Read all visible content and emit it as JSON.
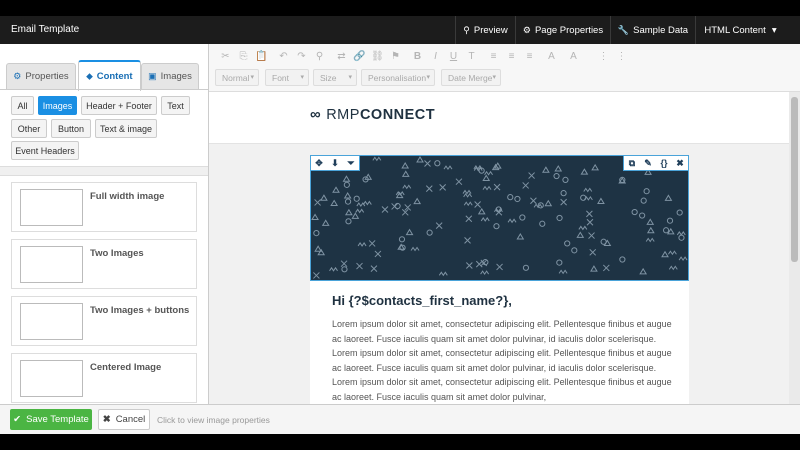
{
  "window": {
    "title": "Email Template"
  },
  "nav": [
    {
      "icon": "search-icon",
      "glyph": "⚲",
      "label": "Preview"
    },
    {
      "icon": "gear-icon",
      "glyph": "⚙",
      "label": "Page Properties"
    },
    {
      "icon": "wrench-icon",
      "glyph": "🔧",
      "label": "Sample Data"
    },
    {
      "icon": "chevron-down-icon",
      "glyph": "▾",
      "label": "HTML Content"
    }
  ],
  "left_tabs": [
    {
      "icon": "gear-icon",
      "glyph": "⚙",
      "label": "Properties"
    },
    {
      "icon": "tag-icon",
      "glyph": "⬥",
      "label": "Content"
    },
    {
      "icon": "image-icon",
      "glyph": "▣",
      "label": "Images"
    }
  ],
  "filters": [
    "All",
    "Images",
    "Header + Footer",
    "Text",
    "Other",
    "Button",
    "Text & image",
    "Event Headers"
  ],
  "active_filter": "Images",
  "blocks": [
    "Full width image",
    "Two Images",
    "Two Images + buttons",
    "Centered Image"
  ],
  "editor_toolbar": {
    "row1_icons": [
      "cut-icon",
      "copy-icon",
      "paste-icon",
      "undo-icon",
      "redo-icon",
      "find-icon",
      "replace-icon",
      "link-icon",
      "unlink-icon",
      "flag-icon",
      "bold-icon",
      "italic-icon",
      "underline-icon",
      "clear-format-icon",
      "align-left-icon",
      "align-center-icon",
      "align-right-icon",
      "font-color-icon",
      "bg-color-icon",
      "numbered-list-icon",
      "bullet-list-icon"
    ],
    "row1_glyphs": [
      "✂",
      "⎘",
      "📋",
      "↶",
      "↷",
      "⚲",
      "⇄",
      "🔗",
      "⛓",
      "⚑",
      "B",
      "I",
      "U",
      "T",
      "≡",
      "≡",
      "≡",
      "A",
      "A",
      "⋮",
      "⋮"
    ],
    "dropdowns": [
      "Normal",
      "Font",
      "Size",
      "Personalisation",
      "Date Merge"
    ]
  },
  "email": {
    "logo_mark": "∞",
    "logo_rmp": "RMP",
    "logo_connect": "CONNECT",
    "image_tools_left": [
      "✥",
      "⬇",
      "⏷"
    ],
    "image_tools_right": [
      "⧉",
      "✎",
      "{}",
      "✖"
    ],
    "greeting": "Hi {?$contacts_first_name?},",
    "body": "Lorem ipsum dolor sit amet, consectetur adipiscing elit. Pellentesque finibus et augue ac laoreet. Fusce iaculis quam sit amet dolor pulvinar, id iaculis dolor scelerisque. Lorem ipsum dolor sit amet, consectetur adipiscing elit. Pellentesque finibus et augue ac laoreet. Fusce iaculis quam sit amet dolor pulvinar, id iaculis dolor scelerisque. Lorem ipsum dolor sit amet, consectetur adipiscing elit. Pellentesque finibus et augue ac laoreet. Fusce iaculis quam sit amet dolor pulvinar,"
  },
  "footer": {
    "save_label": "Save Template",
    "cancel_label": "Cancel",
    "hint": "Click to view image properties"
  },
  "colors": {
    "accent": "#1a8fe3",
    "save": "#4bb543",
    "banner": "#1e3344",
    "topbar": "#1c1c1c"
  }
}
